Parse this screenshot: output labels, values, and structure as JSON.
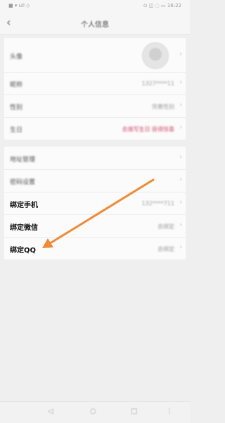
{
  "status": {
    "left": "■ ▾ ull ◇",
    "right": "⊙ ◫ ◌ ▭ 16:22"
  },
  "nav": {
    "back": "‹",
    "title": "个人信息"
  },
  "profile": [
    {
      "label": "头像",
      "value": ""
    },
    {
      "label": "昵称",
      "value": "1327****11"
    },
    {
      "label": "性别",
      "value": "完善性别"
    },
    {
      "label": "生日",
      "value": "去填写生日 获得惊喜"
    }
  ],
  "settings": [
    {
      "label": "地址管理",
      "value": ""
    },
    {
      "label": "密码设置",
      "value": ""
    },
    {
      "label": "绑定手机",
      "value": "132****711"
    },
    {
      "label": "绑定微信",
      "value": "去绑定"
    },
    {
      "label": "绑定QQ",
      "value": "去绑定"
    }
  ],
  "chevron": "›",
  "bottom_nav": {
    "back": "◁",
    "home": "○",
    "recent": "□",
    "extra": "⋮"
  },
  "colors": {
    "arrow": "#ef8a38",
    "accent_text": "#d04a6a"
  },
  "icons": [
    "back-arrow-icon",
    "chevron-right-icon",
    "avatar-icon"
  ]
}
